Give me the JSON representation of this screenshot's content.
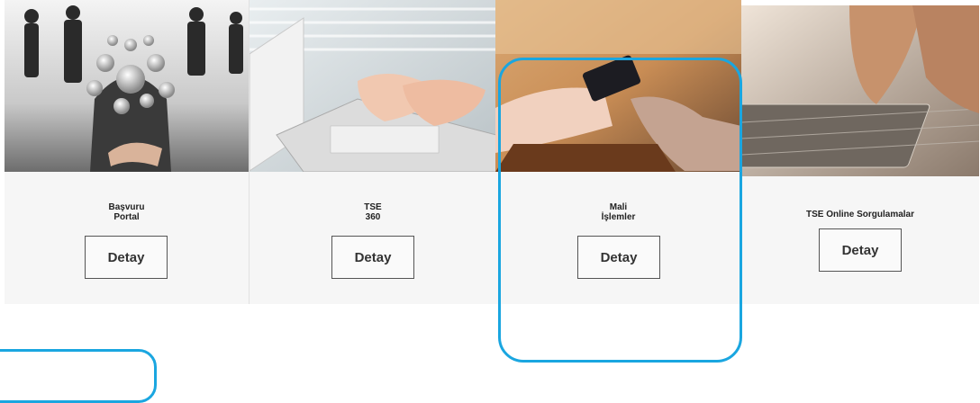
{
  "cards": [
    {
      "title_line1": "Başvuru",
      "title_line2": "Portal",
      "button": "Detay",
      "image": "business-network-photo"
    },
    {
      "title_line1": "TSE",
      "title_line2": "360",
      "button": "Detay",
      "image": "laptop-typing-photo"
    },
    {
      "title_line1": "Mali",
      "title_line2": "İşlemler",
      "button": "Detay",
      "image": "card-payment-photo"
    },
    {
      "title_line1": "TSE Online Sorgulamalar",
      "title_line2": "",
      "button": "Detay",
      "image": "keyboard-typing-photo"
    }
  ],
  "colors": {
    "highlight": "#1aa6e0",
    "card_bg": "#f6f6f6"
  }
}
